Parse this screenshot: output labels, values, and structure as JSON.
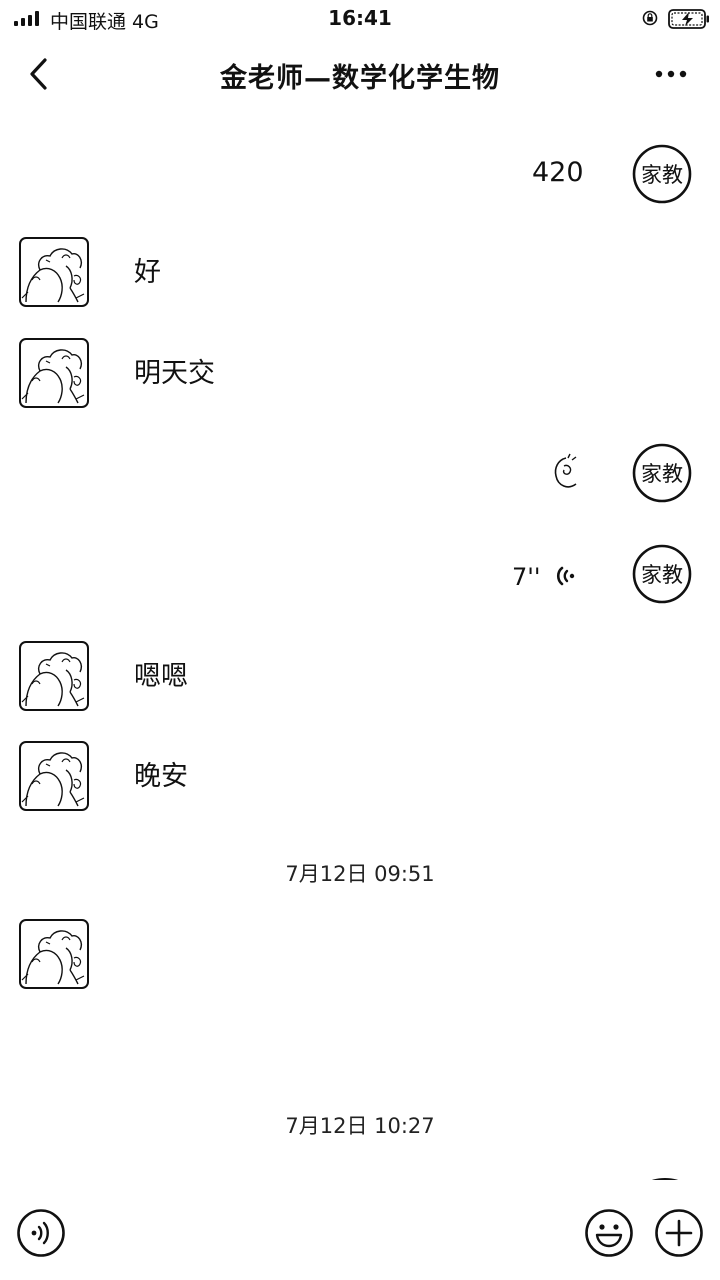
{
  "status_bar": {
    "carrier": "中国联通  4G",
    "time": "16:41"
  },
  "nav": {
    "title": "金老师—数学化学生物"
  },
  "messages": [
    {
      "side": "right",
      "type": "text",
      "text": "420"
    },
    {
      "side": "left",
      "type": "text",
      "text": "好"
    },
    {
      "side": "left",
      "type": "text",
      "text": "明天交"
    },
    {
      "side": "right",
      "type": "emoji",
      "icon": "ok-hand-emoji"
    },
    {
      "side": "right",
      "type": "voice",
      "duration": "7''"
    },
    {
      "side": "left",
      "type": "text",
      "text": "嗯嗯"
    },
    {
      "side": "left",
      "type": "text",
      "text": "晚安"
    },
    {
      "type": "timestamp",
      "text": "7月12日 09:51"
    },
    {
      "side": "left",
      "type": "empty"
    },
    {
      "type": "timestamp",
      "text": "7月12日 10:27"
    }
  ],
  "teacher_avatar_label": "家教",
  "input_bar": {
    "left_icon": "voice-input-icon",
    "right_icons": [
      "emoji-icon",
      "plus-icon"
    ]
  }
}
